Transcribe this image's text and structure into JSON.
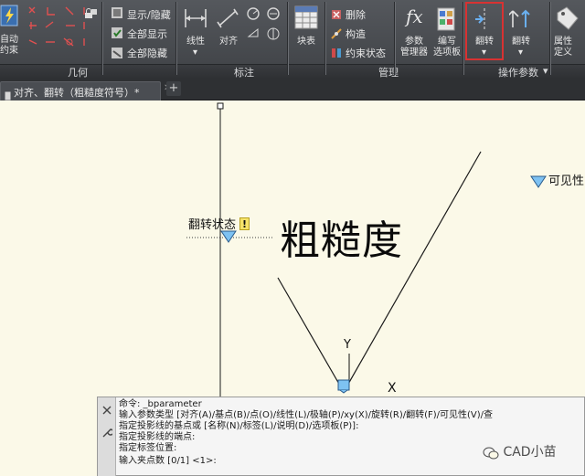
{
  "ribbon": {
    "panels": {
      "geometry": "几何",
      "dimension": "标注",
      "manage": "管理",
      "action_params": "操作参数"
    },
    "auto_constrain": [
      "自动",
      "约束"
    ],
    "show_hide": "显示/隐藏",
    "show_all": "全部显示",
    "hide_all": "全部隐藏",
    "linear": "线性",
    "align": "对齐",
    "block_table": "块表",
    "delete": "删除",
    "construct": "构造",
    "constraint_status": "约束状态",
    "param_manager": [
      "参数",
      "管理器"
    ],
    "author_palette": [
      "编写",
      "选项板"
    ],
    "flip_action": "翻转",
    "flip_param": "翻转",
    "attr_define": [
      "属性",
      "定义"
    ],
    "panel_menu_arrow": "▾",
    "dropdown_arrow": "▾",
    "fx_glyph": "fx"
  },
  "tabs": {
    "document": "对齐、翻转（粗糙度符号）*",
    "close": "✕",
    "new": "+"
  },
  "canvas": {
    "flip_state_label": "翻转状态",
    "warning": "!",
    "roughness_text": "粗糙度",
    "visibility_label": "可见性",
    "ucs_y": "Y",
    "ucs_x": "X"
  },
  "command": {
    "lines": [
      "命令: _bparameter",
      "输入参数类型 [对齐(A)/基点(B)/点(O)/线性(L)/极轴(P)/xy(X)/旋转(R)/翻转(F)/可见性(V)/查",
      "指定投影线的基点或 [名称(N)/标签(L)/说明(D)/选项板(P)]:",
      "指定投影线的端点:",
      "指定标签位置:",
      "输入夹点数 [0/1] <1>:"
    ]
  },
  "watermark": "CAD小苗"
}
